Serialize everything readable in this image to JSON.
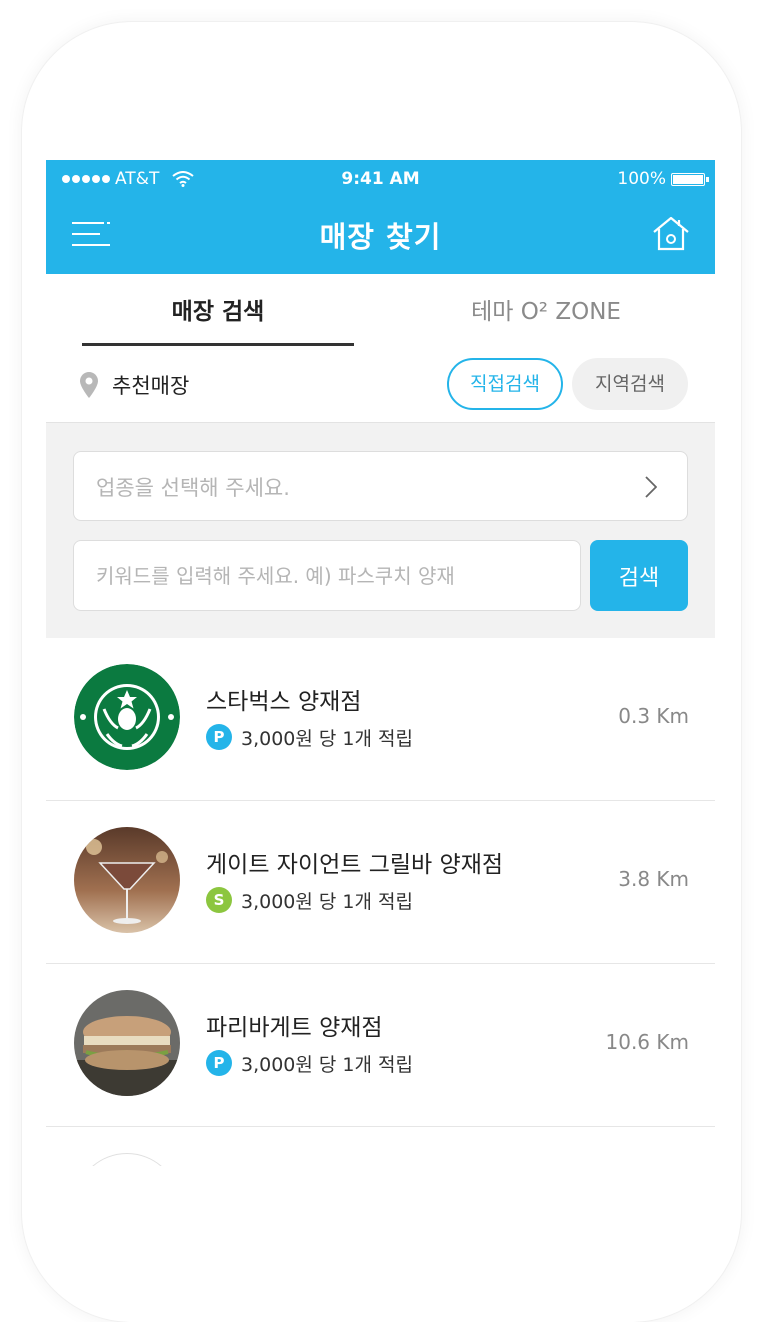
{
  "status_bar": {
    "carrier": "AT&T",
    "time": "9:41 AM",
    "battery": "100%"
  },
  "header": {
    "title": "매장 찾기",
    "menu_icon": "menu-icon",
    "home_icon": "home-icon"
  },
  "tabs": [
    {
      "label": "매장 검색",
      "active": true
    },
    {
      "label": "테마 O² ZONE",
      "active": false
    }
  ],
  "filter": {
    "recommended_label": "추천매장",
    "direct_search": "직접검색",
    "region_search": "지역검색"
  },
  "search": {
    "category_placeholder": "업종을 선택해 주세요.",
    "keyword_placeholder": "키워드를 입력해 주세요. 예) 파스쿠치 양재",
    "search_button": "검색"
  },
  "stores": [
    {
      "name": "스타벅스 양재점",
      "badge": "P",
      "badge_color": "#24b4e9",
      "point_text": "3,000원 당 1개 적립",
      "distance": "0.3 Km"
    },
    {
      "name": "게이트 자이언트 그릴바 양재점",
      "badge": "S",
      "badge_color": "#8cc63f",
      "point_text": "3,000원 당 1개 적립",
      "distance": "3.8 Km"
    },
    {
      "name": "파리바게트 양재점",
      "badge": "P",
      "badge_color": "#24b4e9",
      "point_text": "3,000원 당 1개 적립",
      "distance": "10.6 Km"
    }
  ],
  "colors": {
    "accent": "#24b4e9",
    "secondary_badge": "#8cc63f"
  }
}
